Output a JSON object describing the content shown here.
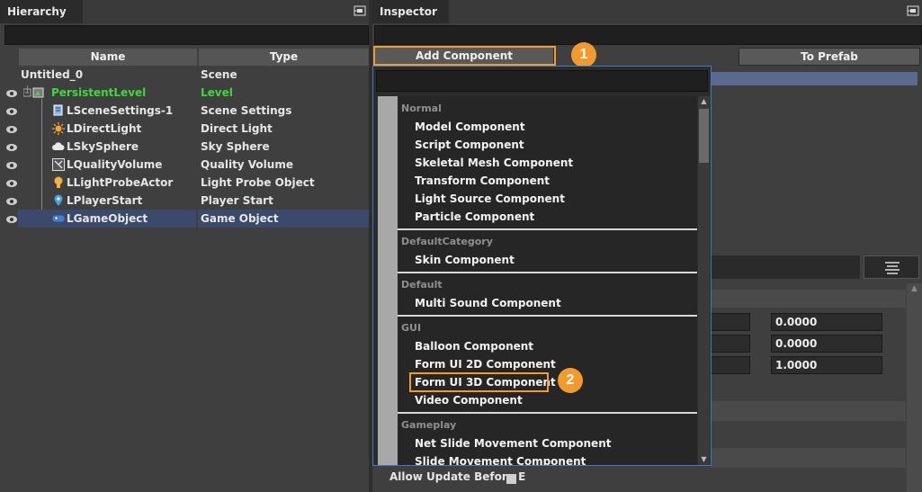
{
  "hierarchy": {
    "title": "Hierarchy",
    "columns": {
      "name": "Name",
      "type": "Type"
    },
    "rows": [
      {
        "name": "Untitled_0",
        "type": "Scene"
      },
      {
        "name": "PersistentLevel",
        "type": "Level"
      },
      {
        "name": "LSceneSettings-1",
        "type": "Scene Settings"
      },
      {
        "name": "LDirectLight",
        "type": "Direct Light"
      },
      {
        "name": "LSkySphere",
        "type": "Sky Sphere"
      },
      {
        "name": "LQualityVolume",
        "type": "Quality Volume"
      },
      {
        "name": "LLightProbeActor",
        "type": "Light Probe Object"
      },
      {
        "name": "LPlayerStart",
        "type": "Player Start"
      },
      {
        "name": "LGameObject",
        "type": "Game Object"
      }
    ]
  },
  "inspector": {
    "title": "Inspector",
    "add_component_label": "Add Component",
    "to_prefab_label": "To Prefab",
    "fields": [
      "0.0000",
      "0.0000",
      "1.0000"
    ],
    "allow_update_label": "Allow Update Before E"
  },
  "callouts": {
    "one": "1",
    "two": "2"
  },
  "menu": {
    "categories": [
      {
        "name": "Normal",
        "items": [
          "Model Component",
          "Script Component",
          "Skeletal Mesh Component",
          "Transform Component",
          "Light Source Component",
          "Particle Component"
        ]
      },
      {
        "name": "DefaultCategory",
        "items": [
          "Skin Component"
        ]
      },
      {
        "name": "Default",
        "items": [
          "Multi Sound Component"
        ]
      },
      {
        "name": "GUI",
        "items": [
          "Balloon Component",
          "Form UI 2D Component",
          "Form UI 3D Component",
          "Video Component"
        ]
      },
      {
        "name": "Gameplay",
        "items": [
          "Net Slide Movement Component",
          "Slide Movement Component"
        ]
      }
    ]
  },
  "colors": {
    "accent_orange": "#f39a2e",
    "level_green": "#3fd83f",
    "selection": "#3b4a6a",
    "dropdown_border": "#3b7dc4"
  }
}
